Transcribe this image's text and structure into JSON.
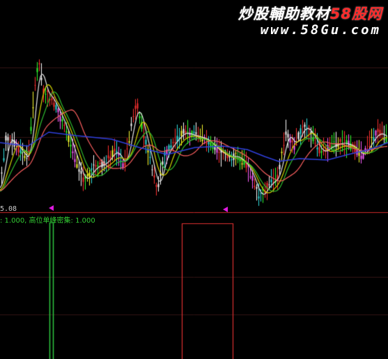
{
  "watermark": {
    "line1_prefix": "炒股輔助教材",
    "line1_brand": "58股网",
    "line2": "www.58Gu.com"
  },
  "price_label": "5.08",
  "indicator_legend": ": 1.000, 高位单峰密集: 1.000",
  "colors": {
    "background": "#000000",
    "separator": "#cc2a2a",
    "grid": "#331414",
    "marker": "#e01ae0",
    "signal_green": "#2ecc40",
    "signal_red": "#e03030",
    "ma_blue": "#3040e0",
    "ma_yellow": "#d8d800",
    "ma_white": "#e8e8e8",
    "ma_green": "#30c030"
  },
  "indicator_signals": [
    {
      "label": "green-spike",
      "value": 1.0
    },
    {
      "label": "red-box",
      "value": 1.0
    }
  ]
}
